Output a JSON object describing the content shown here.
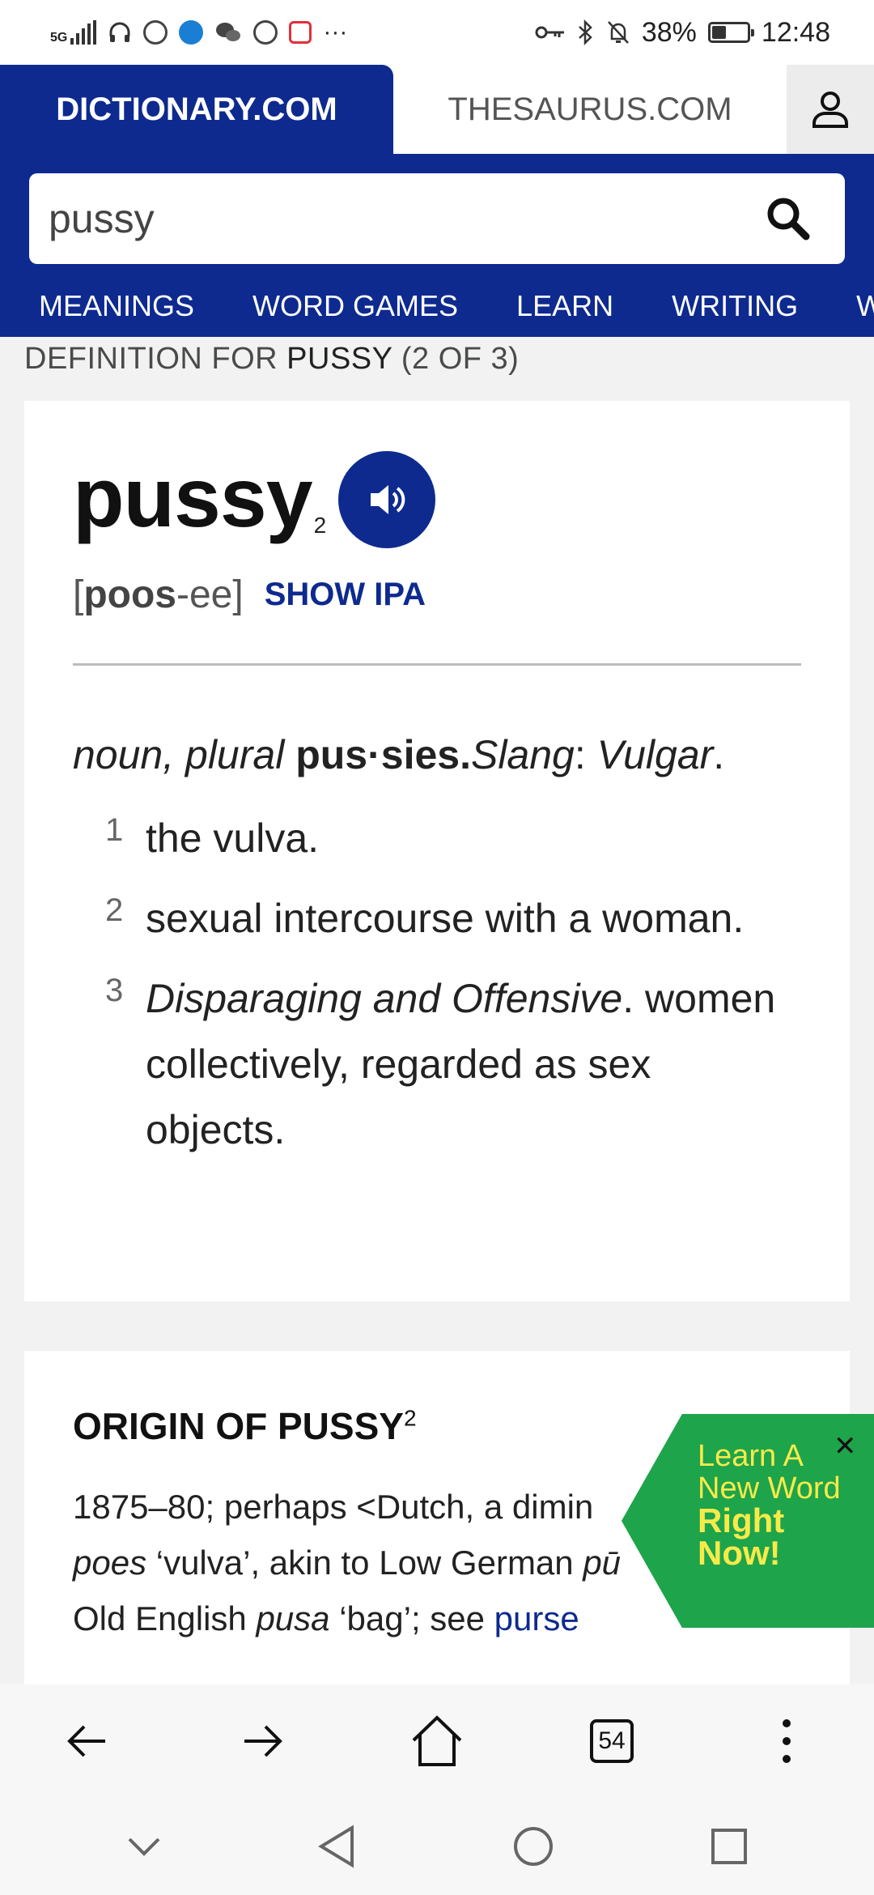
{
  "status_bar": {
    "network": "5G",
    "battery_percent": "38%",
    "battery_level": 0.38,
    "time": "12:48",
    "icons": [
      "signal-icon",
      "headphones-icon",
      "app-icon",
      "browser-icon",
      "wechat-icon",
      "vpn-icon",
      "red-app-icon",
      "more-icon",
      "key-icon",
      "bluetooth-icon",
      "mute-icon",
      "battery-icon"
    ],
    "more": "···"
  },
  "tabs": {
    "dictionary": "DICTIONARY.COM",
    "thesaurus": "THESAURUS.COM"
  },
  "search": {
    "value": "pussy"
  },
  "nav": {
    "items": [
      "MEANINGS",
      "WORD GAMES",
      "LEARN",
      "WRITING",
      "WOR"
    ]
  },
  "definition_heading": {
    "prefix": "DEFINITION FOR ",
    "word": "PUSSY",
    "suffix": " (2 OF 3)"
  },
  "entry": {
    "headword": "pussy",
    "superscript": "2",
    "pron_open": "[ ",
    "pron_stress": "poos",
    "pron_rest": "-ee",
    "pron_close": " ]",
    "show_ipa": "SHOW IPA",
    "pos": "noun, plural",
    "plural": "pus·sies.",
    "label_slang": "Slang",
    "label_colon": ": ",
    "label_vulgar": "Vulgar",
    "label_end": ".",
    "definitions": [
      {
        "num": "1",
        "text": "the vulva."
      },
      {
        "num": "2",
        "text": "sexual intercourse with a woman."
      },
      {
        "num": "3",
        "label": "Disparaging and Offensive",
        "label_end": ".",
        "text": "women collectively, regarded as sex objects."
      }
    ]
  },
  "origin": {
    "title": "ORIGIN OF PUSSY",
    "superscript": "2",
    "line1": "1875–80; perhaps <Dutch, a dimin",
    "line2_italic": "poes",
    "line2_rest": " ‘vulva’, akin to Low German ",
    "line2_tail": "pū",
    "line3_start": "Old English ",
    "line3_italic": "pusa",
    "line3_mid": " ‘bag’; see ",
    "line3_link": "purse"
  },
  "promo": {
    "line1": "Learn A",
    "line2": "New Word",
    "line3": "Right",
    "line4": "Now!",
    "close": "✕",
    "bg_color": "#1ea44a",
    "text_color": "#f7ea4a"
  },
  "browser_bar": {
    "tab_count": "54"
  },
  "colors": {
    "brand_blue": "#0e2a8f",
    "link_blue": "#0e2a8f"
  }
}
